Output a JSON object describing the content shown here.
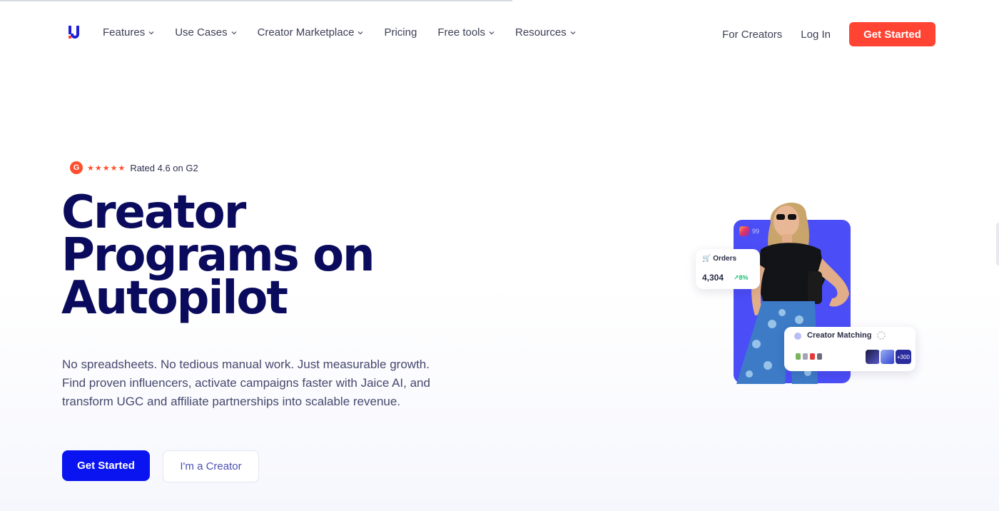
{
  "nav": {
    "links": [
      {
        "label": "Features",
        "dropdown": true
      },
      {
        "label": "Use Cases",
        "dropdown": true
      },
      {
        "label": "Creator Marketplace",
        "dropdown": true
      },
      {
        "label": "Pricing",
        "dropdown": false
      },
      {
        "label": "Free tools",
        "dropdown": true
      },
      {
        "label": "Resources",
        "dropdown": true
      }
    ],
    "for_creators": "For Creators",
    "login": "Log In",
    "get_started": "Get Started"
  },
  "hero": {
    "badge_letter": "G",
    "stars": "★★★★★",
    "rating_text": "Rated 4.6 on G2",
    "headline_line1": "Creator",
    "headline_line2": "Programs on",
    "headline_line3": "Autopilot",
    "sub_line1": "No spreadsheets. No tedious manual work. Just measurable growth.",
    "sub_line2": "Find proven influencers, activate campaigns faster with Jaice AI, and",
    "sub_line3": "transform UGC and affiliate partnerships into scalable revenue.",
    "cta_primary": "Get Started",
    "cta_secondary": "I'm a Creator"
  },
  "visual": {
    "ig_handle": "99",
    "orders_label": "Orders",
    "orders_value": "4,304",
    "orders_change": "8%",
    "matching_label": "Creator Matching",
    "avatar_more": "+300"
  },
  "colors": {
    "brand_red": "#ff4433",
    "brand_blue": "#0a14f0",
    "headline": "#0b0b5e",
    "card_blue": "#4b4df7"
  }
}
